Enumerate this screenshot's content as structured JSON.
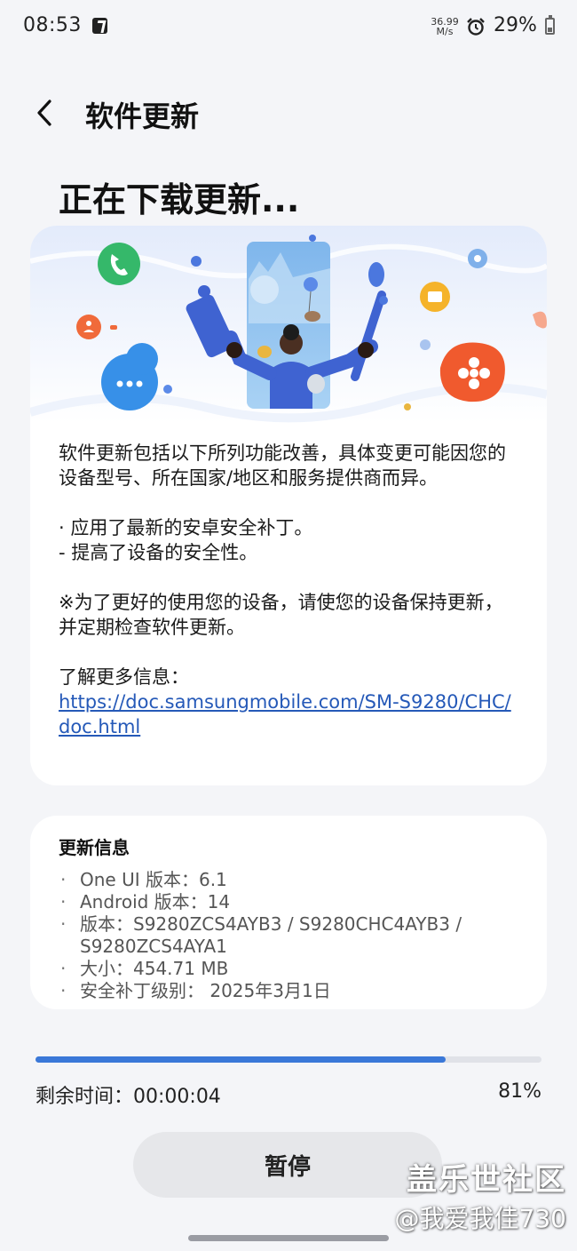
{
  "status_bar": {
    "time": "08:53",
    "net_speed_value": "36.99",
    "net_speed_unit": "M/s",
    "battery": "29%"
  },
  "header": {
    "title": "软件更新"
  },
  "page_title": "正在下载更新...",
  "info": {
    "intro": "软件更新包括以下所列功能改善，具体变更可能因您的设备型号、所在国家/地区和服务提供商而异。",
    "items": [
      "· 应用了最新的安卓安全补丁。",
      "- 提高了设备的安全性。"
    ],
    "note": "※为了更好的使用您的设备，请使您的设备保持更新，并定期检查软件更新。",
    "more_label": "了解更多信息：",
    "link": "https://doc.samsungmobile.com/SM-S9280/CHC/doc.html"
  },
  "update_info": {
    "title": "更新信息",
    "items": [
      "One UI 版本：6.1",
      "Android 版本：14",
      "版本：S9280ZCS4AYB3 / S9280CHC4AYB3 / S9280ZCS4AYA1",
      "大小：454.71 MB",
      "安全补丁级别： 2025年3月1日"
    ]
  },
  "progress": {
    "remaining": "剩余时间：00:00:04",
    "percent_label": "81%",
    "fraction": 0.81
  },
  "pause_label": "暂停",
  "watermark": {
    "community": "盖乐世社区",
    "user": "@我爱我佳730"
  },
  "colors": {
    "accent": "#3a78d8",
    "link": "#2559b8",
    "background": "#f4f5f8"
  }
}
